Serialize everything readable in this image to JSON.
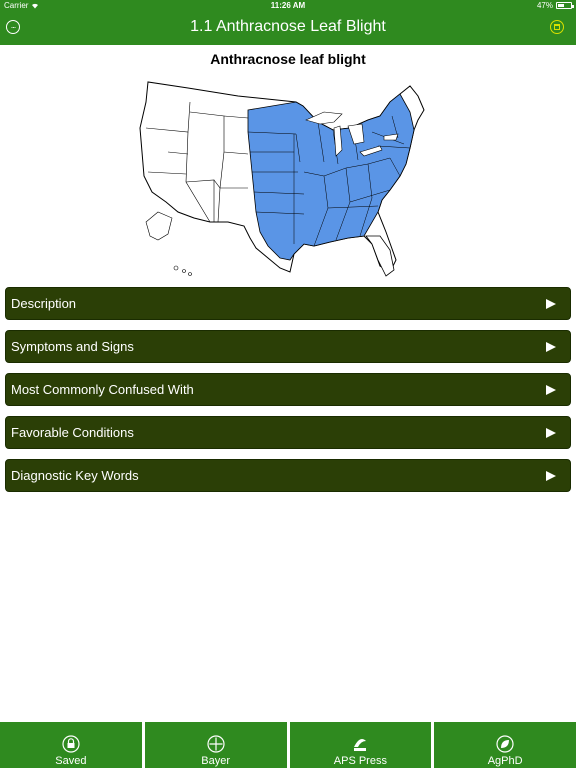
{
  "status": {
    "carrier": "Carrier",
    "time": "11:26 AM",
    "battery": "47%"
  },
  "nav": {
    "title": "1.1 Anthracnose Leaf Blight",
    "menu_icon": "more-icon",
    "save_icon": "save-icon"
  },
  "map": {
    "title": "Anthracnose leaf blight",
    "highlight_color": "#5a95e6"
  },
  "sections": [
    {
      "label": "Description"
    },
    {
      "label": "Symptoms and Signs"
    },
    {
      "label": "Most Commonly Confused With"
    },
    {
      "label": "Favorable Conditions"
    },
    {
      "label": "Diagnostic Key Words"
    }
  ],
  "tabs": [
    {
      "label": "Saved",
      "icon": "lock-icon"
    },
    {
      "label": "Bayer",
      "icon": "bayer-cross-icon"
    },
    {
      "label": "APS Press",
      "icon": "aps-logo-icon"
    },
    {
      "label": "AgPhD",
      "icon": "leaf-icon"
    }
  ],
  "colors": {
    "brand_green": "#2f8a1f",
    "section_bg": "#2b3f06",
    "save_accent": "#d8e000"
  }
}
